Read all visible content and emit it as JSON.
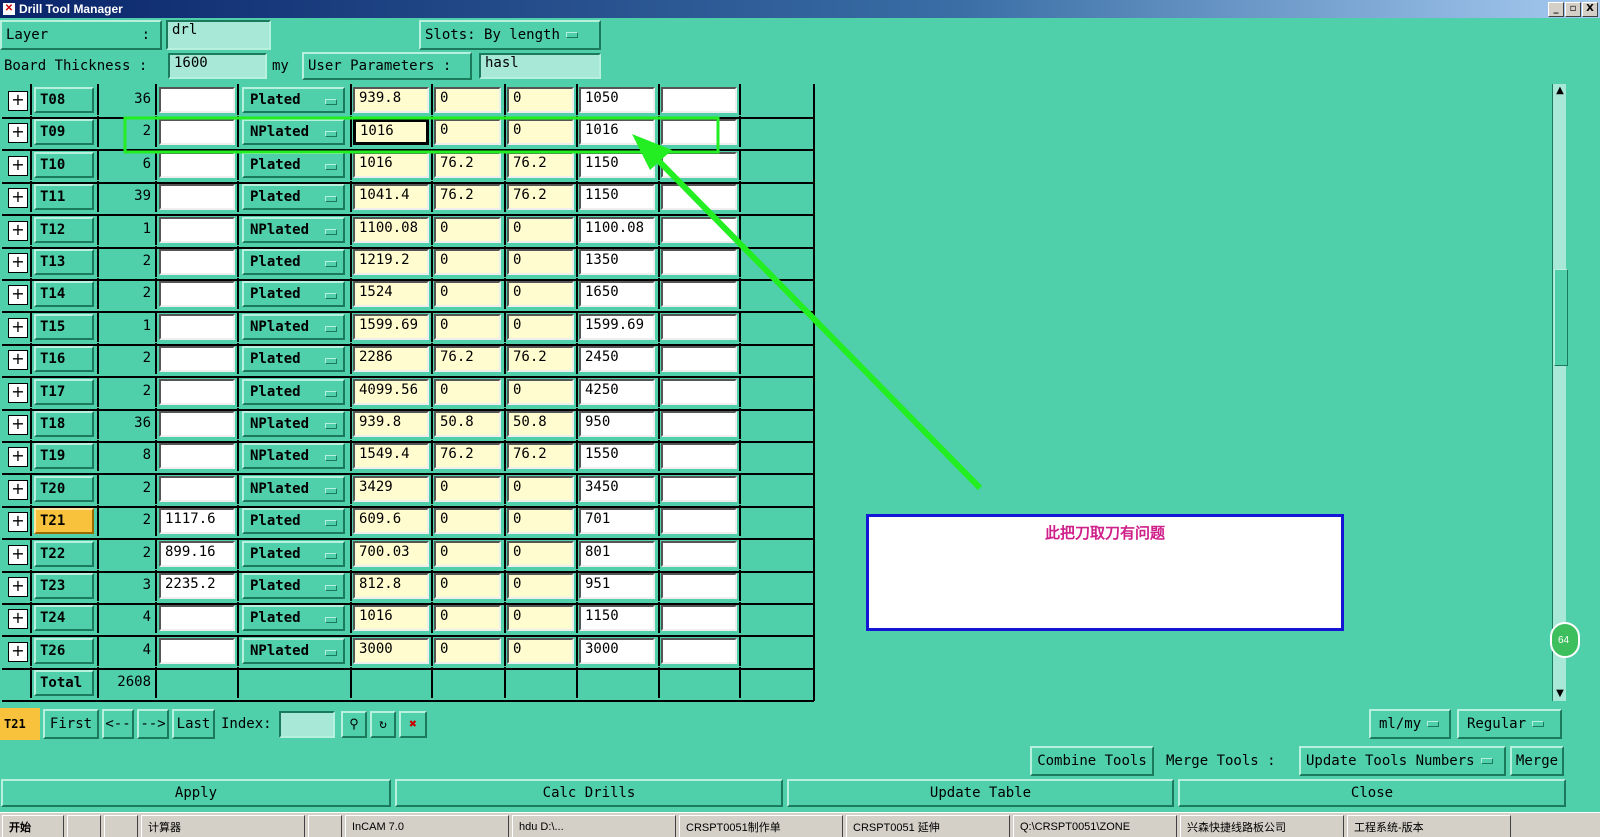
{
  "window": {
    "title": "Drill Tool Manager",
    "minimize": "_",
    "maximize": "▫",
    "close": "X"
  },
  "header": {
    "layer_label": "Layer",
    "layer_colon": ":",
    "layer_value": "drl",
    "slots_label": "Slots:",
    "slots_value": "By length",
    "thickness_label": "Board Thickness :",
    "thickness_value": "1600",
    "thickness_unit": "my",
    "user_params_label": "User Parameters :",
    "user_params_value": "hasl"
  },
  "tools": [
    {
      "name": "T08",
      "count": "36",
      "f1": "",
      "plating": "Plated",
      "drill": "939.8",
      "a": "0",
      "b": "0",
      "finish": "1050",
      "f2": ""
    },
    {
      "name": "T09",
      "count": "2",
      "f1": "",
      "plating": "NPlated",
      "drill": "1016",
      "a": "0",
      "b": "0",
      "finish": "1016",
      "f2": ""
    },
    {
      "name": "T10",
      "count": "6",
      "f1": "",
      "plating": "Plated",
      "drill": "1016",
      "a": "76.2",
      "b": "76.2",
      "finish": "1150",
      "f2": ""
    },
    {
      "name": "T11",
      "count": "39",
      "f1": "",
      "plating": "Plated",
      "drill": "1041.4",
      "a": "76.2",
      "b": "76.2",
      "finish": "1150",
      "f2": ""
    },
    {
      "name": "T12",
      "count": "1",
      "f1": "",
      "plating": "NPlated",
      "drill": "1100.08",
      "a": "0",
      "b": "0",
      "finish": "1100.08",
      "f2": ""
    },
    {
      "name": "T13",
      "count": "2",
      "f1": "",
      "plating": "Plated",
      "drill": "1219.2",
      "a": "0",
      "b": "0",
      "finish": "1350",
      "f2": ""
    },
    {
      "name": "T14",
      "count": "2",
      "f1": "",
      "plating": "Plated",
      "drill": "1524",
      "a": "0",
      "b": "0",
      "finish": "1650",
      "f2": ""
    },
    {
      "name": "T15",
      "count": "1",
      "f1": "",
      "plating": "NPlated",
      "drill": "1599.69",
      "a": "0",
      "b": "0",
      "finish": "1599.69",
      "f2": ""
    },
    {
      "name": "T16",
      "count": "2",
      "f1": "",
      "plating": "Plated",
      "drill": "2286",
      "a": "76.2",
      "b": "76.2",
      "finish": "2450",
      "f2": ""
    },
    {
      "name": "T17",
      "count": "2",
      "f1": "",
      "plating": "Plated",
      "drill": "4099.56",
      "a": "0",
      "b": "0",
      "finish": "4250",
      "f2": ""
    },
    {
      "name": "T18",
      "count": "36",
      "f1": "",
      "plating": "NPlated",
      "drill": "939.8",
      "a": "50.8",
      "b": "50.8",
      "finish": "950",
      "f2": ""
    },
    {
      "name": "T19",
      "count": "8",
      "f1": "",
      "plating": "NPlated",
      "drill": "1549.4",
      "a": "76.2",
      "b": "76.2",
      "finish": "1550",
      "f2": ""
    },
    {
      "name": "T20",
      "count": "2",
      "f1": "",
      "plating": "NPlated",
      "drill": "3429",
      "a": "0",
      "b": "0",
      "finish": "3450",
      "f2": ""
    },
    {
      "name": "T21",
      "count": "2",
      "f1": "1117.6",
      "plating": "Plated",
      "drill": "609.6",
      "a": "0",
      "b": "0",
      "finish": "701",
      "f2": ""
    },
    {
      "name": "T22",
      "count": "2",
      "f1": "899.16",
      "plating": "Plated",
      "drill": "700.03",
      "a": "0",
      "b": "0",
      "finish": "801",
      "f2": ""
    },
    {
      "name": "T23",
      "count": "3",
      "f1": "2235.2",
      "plating": "Plated",
      "drill": "812.8",
      "a": "0",
      "b": "0",
      "finish": "951",
      "f2": ""
    },
    {
      "name": "T24",
      "count": "4",
      "f1": "",
      "plating": "Plated",
      "drill": "1016",
      "a": "0",
      "b": "0",
      "finish": "1150",
      "f2": ""
    },
    {
      "name": "T26",
      "count": "4",
      "f1": "",
      "plating": "NPlated",
      "drill": "3000",
      "a": "0",
      "b": "0",
      "finish": "3000",
      "f2": ""
    }
  ],
  "total": {
    "label": "Total",
    "value": "2608"
  },
  "annotation": {
    "note": "此把刀取刀有问题",
    "arrow_color": "#22ee22",
    "box_color": "#1515d6"
  },
  "nav": {
    "current": "T21",
    "first": "First",
    "prev": "<--",
    "next": "-->",
    "last": "Last",
    "index_label": "Index:",
    "index_value": "",
    "units": "ml/my",
    "mode": "Regular"
  },
  "actions": {
    "combine": "Combine Tools",
    "merge_label": "Merge Tools :",
    "update_numbers": "Update Tools Numbers",
    "merge": "Merge",
    "apply": "Apply",
    "calc": "Calc Drills",
    "update_table": "Update Table",
    "close": "Close"
  },
  "scroll": {
    "badge": "64"
  },
  "taskbar": [
    "开始",
    "",
    "",
    "计算器",
    "",
    "InCAM 7.0",
    "hdu D:\\...",
    "CRSPT0051制作单",
    "CRSPT0051 延伸",
    "Q:\\CRSPT0051\\ZONE",
    "兴森快捷线路板公司",
    "工程系统-版本"
  ]
}
